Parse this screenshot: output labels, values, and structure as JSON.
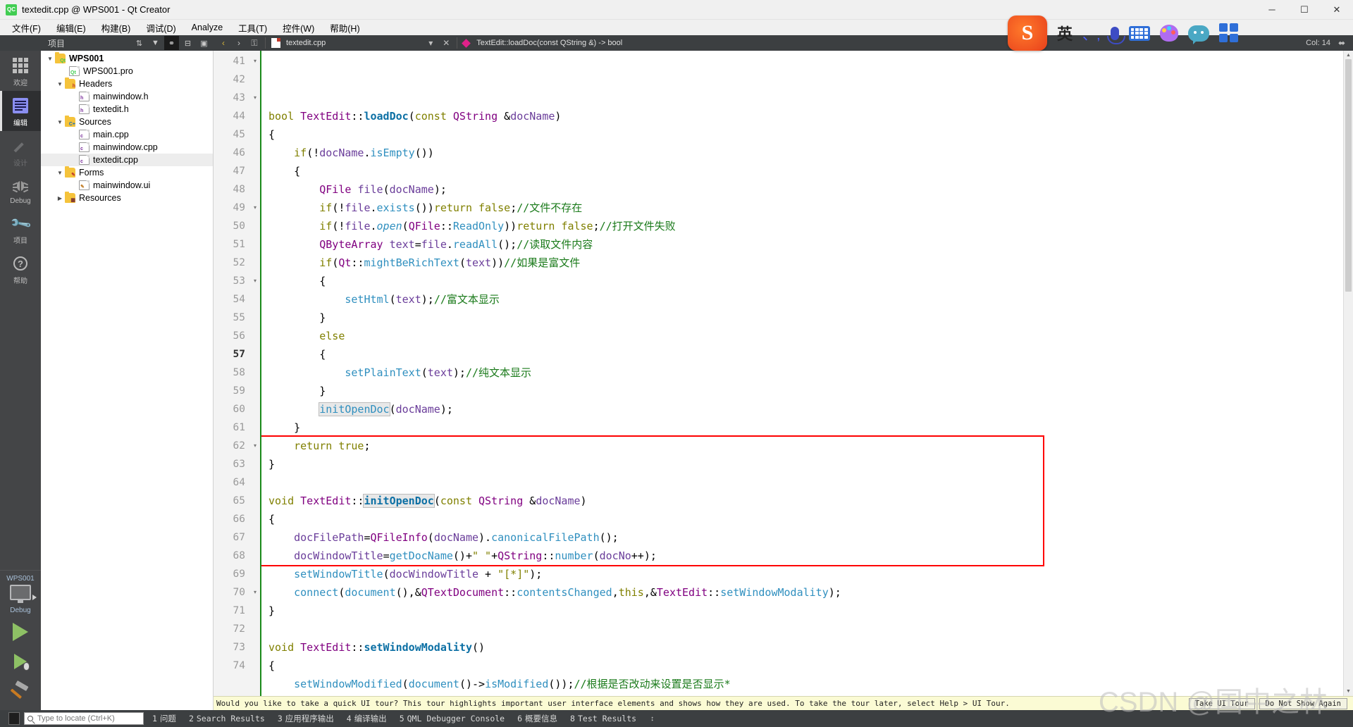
{
  "window": {
    "title": "textedit.cpp @ WPS001 - Qt Creator",
    "app_icon": "qt-creator-icon",
    "minimize": "─",
    "maximize": "☐",
    "close": "✕"
  },
  "menubar": {
    "items": [
      {
        "label": "文件(F)"
      },
      {
        "label": "编辑(E)"
      },
      {
        "label": "构建(B)"
      },
      {
        "label": "调试(D)"
      },
      {
        "label": "Analyze"
      },
      {
        "label": "工具(T)"
      },
      {
        "label": "控件(W)"
      },
      {
        "label": "帮助(H)"
      }
    ]
  },
  "modebar": {
    "items": [
      {
        "label": "欢迎",
        "icon": "grid-icon",
        "selected": false,
        "disabled": false
      },
      {
        "label": "编辑",
        "icon": "edit-document-icon",
        "selected": true,
        "disabled": false
      },
      {
        "label": "设计",
        "icon": "pencil-icon",
        "selected": false,
        "disabled": true
      },
      {
        "label": "Debug",
        "icon": "bug-icon",
        "selected": false,
        "disabled": false
      },
      {
        "label": "项目",
        "icon": "wrench-icon",
        "selected": false,
        "disabled": false
      },
      {
        "label": "帮助",
        "icon": "question-mark-icon",
        "selected": false,
        "disabled": false
      }
    ],
    "kit": {
      "project_name": "WPS001",
      "build_config": "Debug",
      "monitor_icon": "desktop-kit-icon",
      "run_icon": "run-play-icon",
      "debug_icon": "debug-play-icon",
      "build_icon": "hammer-build-icon"
    }
  },
  "project_panel": {
    "title": "项目",
    "toolbar_icons": [
      {
        "name": "sort-icon",
        "glyph": "⇅"
      },
      {
        "name": "filter-icon",
        "glyph": "▼"
      },
      {
        "name": "link-sync-icon",
        "glyph": "⚭",
        "active": true
      },
      {
        "name": "collapse-all-icon",
        "glyph": "⊟"
      },
      {
        "name": "split-icon",
        "glyph": "▣"
      }
    ],
    "tree": [
      {
        "label": "WPS001",
        "depth": 0,
        "twisty": "down",
        "icon": "folder-qt",
        "tag": "Qt",
        "bold": true,
        "selected": false
      },
      {
        "label": "WPS001.pro",
        "depth": 1,
        "twisty": "",
        "icon": "doc-qt",
        "tag": "Qt",
        "bold": false,
        "selected": false
      },
      {
        "label": "Headers",
        "depth": 1,
        "twisty": "down",
        "icon": "folder-h",
        "tag": "h",
        "bold": false,
        "selected": false
      },
      {
        "label": "mainwindow.h",
        "depth": 2,
        "twisty": "",
        "icon": "doc-h",
        "tag": "h",
        "bold": false,
        "selected": false
      },
      {
        "label": "textedit.h",
        "depth": 2,
        "twisty": "",
        "icon": "doc-h",
        "tag": "h",
        "bold": false,
        "selected": false
      },
      {
        "label": "Sources",
        "depth": 1,
        "twisty": "down",
        "icon": "folder-cpp",
        "tag": "C+",
        "bold": false,
        "selected": false
      },
      {
        "label": "main.cpp",
        "depth": 2,
        "twisty": "",
        "icon": "doc-cpp",
        "tag": "c",
        "bold": false,
        "selected": false
      },
      {
        "label": "mainwindow.cpp",
        "depth": 2,
        "twisty": "",
        "icon": "doc-cpp",
        "tag": "c",
        "bold": false,
        "selected": false
      },
      {
        "label": "textedit.cpp",
        "depth": 2,
        "twisty": "",
        "icon": "doc-cpp",
        "tag": "c",
        "bold": false,
        "selected": true
      },
      {
        "label": "Forms",
        "depth": 1,
        "twisty": "down",
        "icon": "folder-ui",
        "tag": "",
        "bold": false,
        "selected": false
      },
      {
        "label": "mainwindow.ui",
        "depth": 2,
        "twisty": "",
        "icon": "doc-ui",
        "tag": "",
        "bold": false,
        "selected": false
      },
      {
        "label": "Resources",
        "depth": 1,
        "twisty": "right",
        "icon": "folder-res",
        "tag": "",
        "bold": false,
        "selected": false
      }
    ]
  },
  "editor_toolbar": {
    "back_icon": "‹",
    "forward_icon": "›",
    "lock_icon": "⚿",
    "file_combo": "textedit.cpp",
    "symbol_combo": "TextEdit::loadDoc(const QString &) -> bool",
    "close_icon": "✕",
    "split_icon": "▲",
    "column_indicator": "Col: 14",
    "extra_icon": "⬌"
  },
  "code": {
    "first_line": 41,
    "current_line": 57,
    "lines": [
      {
        "n": 41,
        "fold": "▾",
        "html": "<span class=\"kw\">bool</span> <span class=\"type\">TextEdit</span>::<span class=\"fn\">loadDoc</span>(<span class=\"kw\">const</span> <span class=\"type\">QString</span> &amp;<span class=\"var\">docName</span>)"
      },
      {
        "n": 42,
        "fold": "",
        "html": "{"
      },
      {
        "n": 43,
        "fold": "▾",
        "html": "    <span class=\"kw\">if</span>(!<span class=\"var\">docName</span>.<span class=\"mem\">isEmpty</span>())"
      },
      {
        "n": 44,
        "fold": "",
        "html": "    {"
      },
      {
        "n": 45,
        "fold": "",
        "html": "        <span class=\"type\">QFile</span> <span class=\"var\">file</span>(<span class=\"var\">docName</span>);"
      },
      {
        "n": 46,
        "fold": "",
        "html": "        <span class=\"kw\">if</span>(!<span class=\"var\">file</span>.<span class=\"mem\">exists</span>())<span class=\"kw\">return</span> <span class=\"kw\">false</span>;<span class=\"cmt\">//文件不存在</span>"
      },
      {
        "n": 47,
        "fold": "",
        "html": "        <span class=\"kw\">if</span>(!<span class=\"var\">file</span>.<span class=\"memi\">open</span>(<span class=\"type\">QFile</span>::<span class=\"mem\">ReadOnly</span>))<span class=\"kw\">return</span> <span class=\"kw\">false</span>;<span class=\"cmt\">//打开文件失败</span>"
      },
      {
        "n": 48,
        "fold": "",
        "html": "        <span class=\"type\">QByteArray</span> <span class=\"var\">text</span>=<span class=\"var\">file</span>.<span class=\"mem\">readAll</span>();<span class=\"cmt\">//读取文件内容</span>"
      },
      {
        "n": 49,
        "fold": "▾",
        "html": "        <span class=\"kw\">if</span>(<span class=\"type\">Qt</span>::<span class=\"mem\">mightBeRichText</span>(<span class=\"var\">text</span>))<span class=\"cmt\">//如果是富文件</span>"
      },
      {
        "n": 50,
        "fold": "",
        "html": "        {"
      },
      {
        "n": 51,
        "fold": "",
        "html": "            <span class=\"mem\">setHtml</span>(<span class=\"var\">text</span>);<span class=\"cmt\">//富文本显示</span>"
      },
      {
        "n": 52,
        "fold": "",
        "html": "        }"
      },
      {
        "n": 53,
        "fold": "▾",
        "html": "        <span class=\"kw\">else</span>"
      },
      {
        "n": 54,
        "fold": "",
        "html": "        {"
      },
      {
        "n": 55,
        "fold": "",
        "html": "            <span class=\"mem\">setPlainText</span>(<span class=\"var\">text</span>);<span class=\"cmt\">//纯文本显示</span>"
      },
      {
        "n": 56,
        "fold": "",
        "html": "        }"
      },
      {
        "n": 57,
        "fold": "",
        "html": "        <span class=\"mem occ\">initOpenDoc</span>(<span class=\"var\">docName</span>);"
      },
      {
        "n": 58,
        "fold": "",
        "html": "    }"
      },
      {
        "n": 59,
        "fold": "",
        "html": "    <span class=\"kw\">return</span> <span class=\"kw\">true</span>;"
      },
      {
        "n": 60,
        "fold": "",
        "html": "}"
      },
      {
        "n": 61,
        "fold": "",
        "html": ""
      },
      {
        "n": 62,
        "fold": "▾",
        "html": "<span class=\"kw\">void</span> <span class=\"type\">TextEdit</span>::<span class=\"fn occ\">initOpenDoc</span>(<span class=\"kw\">const</span> <span class=\"type\">QString</span> &amp;<span class=\"var\">docName</span>)"
      },
      {
        "n": 63,
        "fold": "",
        "html": "{"
      },
      {
        "n": 64,
        "fold": "",
        "html": "    <span class=\"var\">docFilePath</span>=<span class=\"type\">QFileInfo</span>(<span class=\"var\">docName</span>).<span class=\"mem\">canonicalFilePath</span>();"
      },
      {
        "n": 65,
        "fold": "",
        "html": "    <span class=\"var\">docWindowTitle</span>=<span class=\"mem\">getDocName</span>()+<span class=\"kw\">\" \"</span>+<span class=\"type\">QString</span>::<span class=\"mem\">number</span>(<span class=\"var\">docNo</span>++);"
      },
      {
        "n": 66,
        "fold": "",
        "html": "    <span class=\"mem\">setWindowTitle</span>(<span class=\"var\">docWindowTitle</span> + <span class=\"kw\">\"[*]\"</span>);"
      },
      {
        "n": 67,
        "fold": "",
        "html": "    <span class=\"mem\">connect</span>(<span class=\"mem\">document</span>(),&amp;<span class=\"type\">QTextDocument</span>::<span class=\"mem\">contentsChanged</span>,<span class=\"kw\">this</span>,&amp;<span class=\"type\">TextEdit</span>::<span class=\"mem\">setWindowModality</span>);"
      },
      {
        "n": 68,
        "fold": "",
        "html": "}"
      },
      {
        "n": 69,
        "fold": "",
        "html": ""
      },
      {
        "n": 70,
        "fold": "▾",
        "html": "<span class=\"kw\">void</span> <span class=\"type\">TextEdit</span>::<span class=\"fn\">setWindowModality</span>()"
      },
      {
        "n": 71,
        "fold": "",
        "html": "{"
      },
      {
        "n": 72,
        "fold": "",
        "html": "    <span class=\"mem\">setWindowModified</span>(<span class=\"mem\">document</span>()-&gt;<span class=\"mem\">isModified</span>());<span class=\"cmt\">//根据是否改动来设置是否显示*</span>"
      },
      {
        "n": 73,
        "fold": "",
        "html": "}"
      },
      {
        "n": 74,
        "fold": "",
        "html": ""
      }
    ],
    "annotation": {
      "name": "red-highlight-box",
      "from_line": 62,
      "to_line": 68,
      "color": "#fe0000"
    }
  },
  "infobar": {
    "message": "Would you like to take a quick UI tour? This tour highlights important user interface elements and shows how they are used. To take the tour later, select Help > UI Tour.",
    "buttons": [
      {
        "label": "Take UI Tour"
      },
      {
        "label": "Do Not Show Again"
      }
    ]
  },
  "statusbar": {
    "sidebar_toggle_icon": "sidebar-toggle-icon",
    "locator_placeholder": "Type to locate (Ctrl+K)",
    "locator_value": "",
    "panels": [
      {
        "num": "1",
        "label": "问题"
      },
      {
        "num": "2",
        "label": "Search Results"
      },
      {
        "num": "3",
        "label": "应用程序输出"
      },
      {
        "num": "4",
        "label": "编译输出"
      },
      {
        "num": "5",
        "label": "QML Debugger Console"
      },
      {
        "num": "6",
        "label": "概要信息"
      },
      {
        "num": "8",
        "label": "Test Results"
      }
    ],
    "resize_handle_icon": "↕"
  },
  "ime_bar": {
    "logo": "S",
    "mode_label": "英",
    "punct_label": "、,",
    "icons": [
      {
        "name": "microphone-icon"
      },
      {
        "name": "keyboard-icon"
      },
      {
        "name": "palette-icon"
      },
      {
        "name": "chat-bubble-icon"
      },
      {
        "name": "app-grid-icon"
      }
    ]
  },
  "watermark": {
    "text": "CSDN @国中之林"
  },
  "colors": {
    "accent_green": "#41cd52",
    "annotation_red": "#fe0000",
    "dark_chrome": "#3c3f41",
    "mode_bar": "#444547",
    "info_bar": "#fbfbd4"
  }
}
